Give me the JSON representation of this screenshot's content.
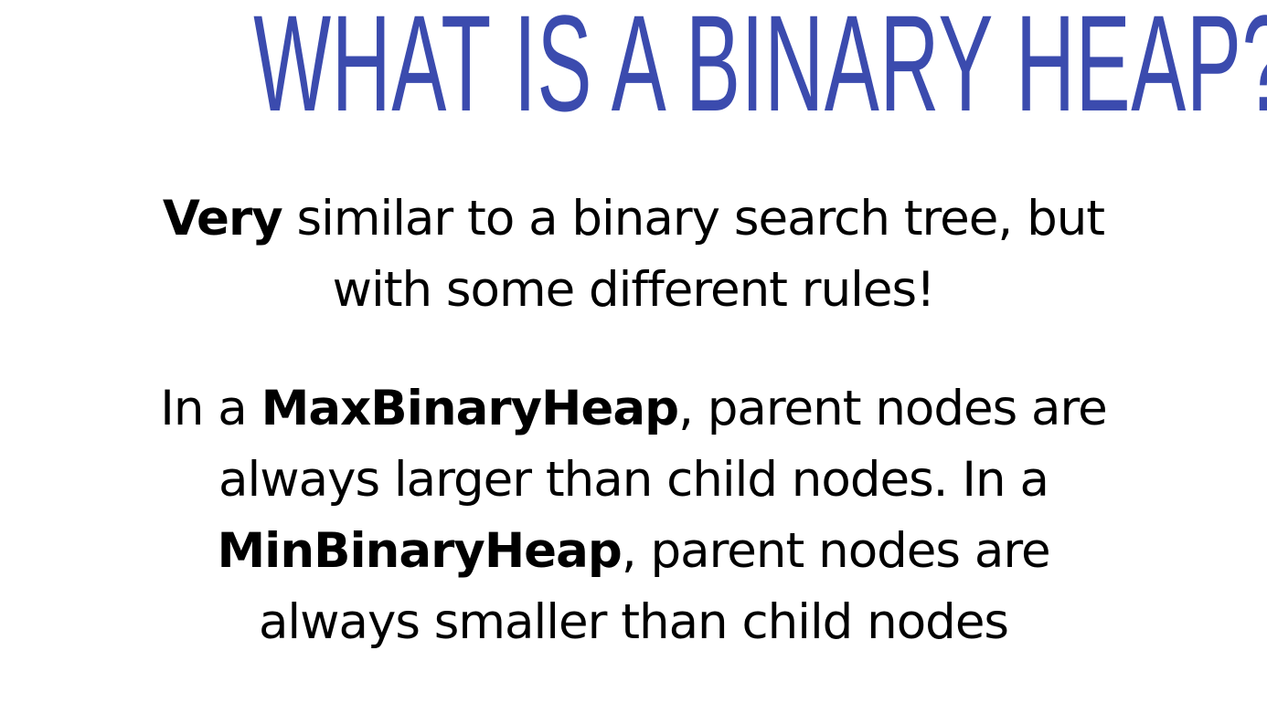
{
  "slide": {
    "title": "WHAT IS A BINARY HEAP?",
    "title_color": "#3B4BAE",
    "paragraph1": {
      "line1_bold": "Very",
      "line1_rest": " similar to a binary search tree, but",
      "line2": "with some different rules!"
    },
    "paragraph2": {
      "line1_pre": "In a ",
      "line1_bold": "MaxBinaryHeap",
      "line1_post": ", parent nodes are",
      "line2": "always larger than child nodes. In a",
      "line3_bold": "MinBinaryHeap",
      "line3_post": ", parent nodes are",
      "line4": "always smaller than child nodes"
    }
  }
}
